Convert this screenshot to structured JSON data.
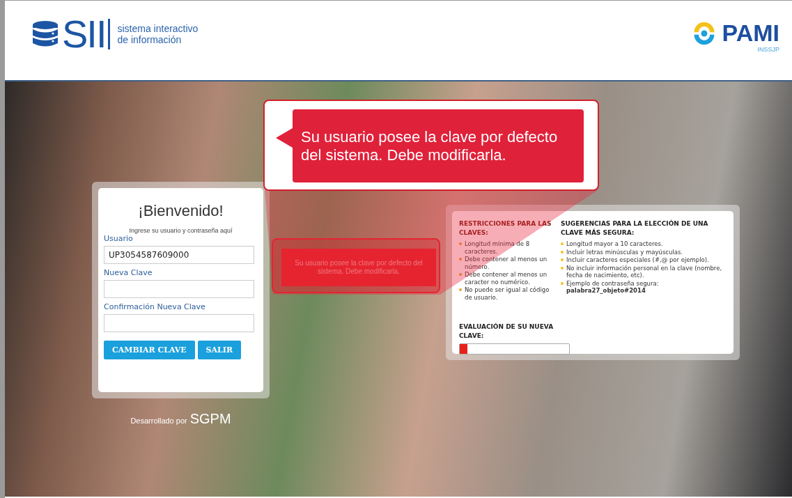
{
  "header": {
    "logo_text": "SII",
    "logo_tagline": [
      "sistema interactivo",
      "de información"
    ],
    "partner_name": "PAMI",
    "partner_subtitle": "INSSJP"
  },
  "login": {
    "title": "¡Bienvenido!",
    "subtitle": "Ingrese su usuario y contraseña aquí",
    "fields": [
      {
        "label": "Usuario",
        "value": "UP3054587609000"
      },
      {
        "label": "Nueva Clave"
      },
      {
        "label": "Confirmación Nueva Clave"
      }
    ],
    "buttons": [
      "CAMBIAR CLAVE",
      "SALIR"
    ]
  },
  "credit": {
    "prefix": "Desarrollado por",
    "brand": "SGPM"
  },
  "message": "Su usuario posee la clave por defecto del sistema. Debe modificarla.",
  "rules": {
    "restrictions": {
      "title": "RESTRICCIONES PARA LAS CLAVES:",
      "items": [
        "Longitud mínima de 8 caracteres.",
        "Debe contener al menos un número.",
        "Debe contener al menos un caracter no numérico.",
        "No puede ser igual al código de usuario."
      ]
    },
    "suggestions": {
      "title": "SUGERENCIAS PARA LA ELECCIÓN DE UNA CLAVE MÁS SEGURA:",
      "items": [
        "Longitud mayor a 10 caracteres.",
        "Incluir letras minúsculas y mayúsculas.",
        "Incluir caracteres especiales (#,@ por ejemplo).",
        "No incluir información personal en la clave (nombre, fecha de nacimiento, etc).",
        "Ejemplo de contraseña segura: **palabra27_objeto#2014**"
      ]
    },
    "strength": {
      "title": "EVALUACIÓN DE SU NUEVA CLAVE:",
      "level": 0.07,
      "color": "#e8221a"
    }
  },
  "callout": {
    "message": "Su usuario posee la clave por defecto del sistema. Debe modificarla."
  }
}
